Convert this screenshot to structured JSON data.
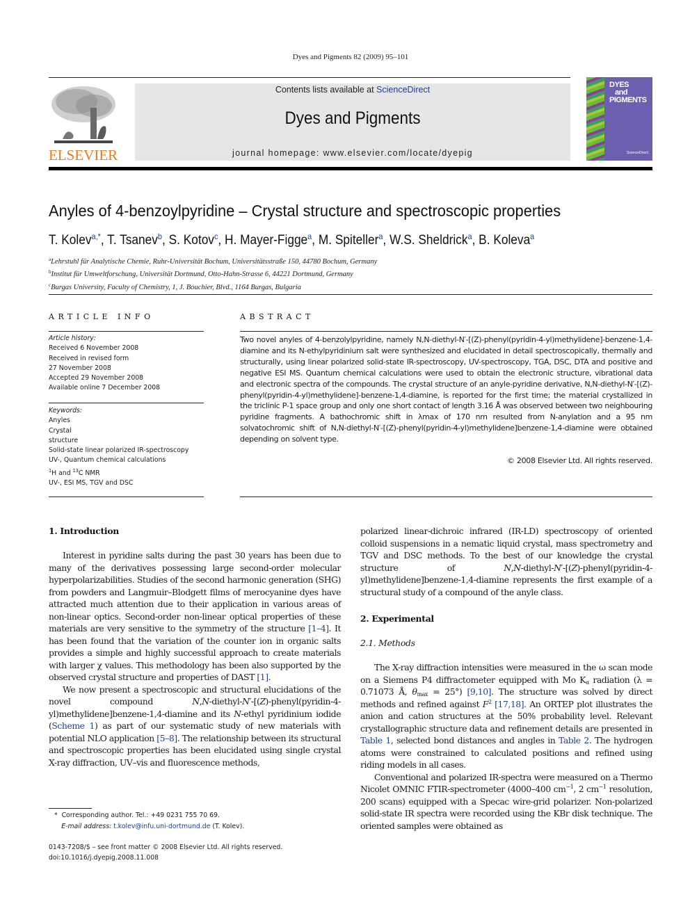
{
  "running_head": "Dyes and Pigments 82 (2009) 95–101",
  "publisher": {
    "logo_text": "ELSEVIER",
    "logo_icon": "elsevier-tree-icon",
    "brand_color": "#e87a1e"
  },
  "banner": {
    "contents_prefix": "Contents lists available at ",
    "contents_link": "ScienceDirect",
    "journal_title": "Dyes and Pigments",
    "homepage_label": "journal homepage: www.elsevier.com/locate/dyepig"
  },
  "cover": {
    "title_lines": [
      "DYES",
      "and",
      "PIGMENTS"
    ],
    "publisher_mark": "ScienceDirect"
  },
  "article": {
    "title": "Anyles of 4-benzoylpyridine – Crystal structure and spectroscopic properties",
    "authors": [
      {
        "name": "T. Kolev",
        "aff": "a,*"
      },
      {
        "name": "T. Tsanev",
        "aff": "b"
      },
      {
        "name": "S. Kotov",
        "aff": "c"
      },
      {
        "name": "H. Mayer-Figge",
        "aff": "a"
      },
      {
        "name": "M. Spiteller",
        "aff": "a"
      },
      {
        "name": "W.S. Sheldrick",
        "aff": "a"
      },
      {
        "name": "B. Koleva",
        "aff": "a"
      }
    ],
    "affiliations": [
      {
        "key": "a",
        "text": "Lehrstuhl für Analytische Chemie, Ruhr-Universität Bochum, Universitätsstraße 150, 44780 Bochum, Germany"
      },
      {
        "key": "b",
        "text": "Institut für Umweltforschung, Universität Dortmund, Otto-Hahn-Strasse 6, 44221 Dortmund, Germany"
      },
      {
        "key": "c",
        "text": "Burgas University, Faculty of Chemistry, 1, J. Bouchier, Blvd., 1164 Burgas, Bulgaria"
      }
    ]
  },
  "article_info": {
    "label": "ARTICLE INFO",
    "history_heading": "Article history:",
    "history": [
      "Received 6 November 2008",
      "Received in revised form",
      "27 November 2008",
      "Accepted 29 November 2008",
      "Available online 7 December 2008"
    ],
    "keywords_heading": "Keywords:",
    "keywords": [
      "Anyles",
      "Crystal",
      "structure",
      "Solid-state linear polarized IR-spectroscopy",
      "UV-, Quantum chemical calculations",
      "1H and 13C NMR",
      "UV-, ESI MS, TGV and DSC"
    ]
  },
  "abstract": {
    "label": "ABSTRACT",
    "text": "Two novel anyles of 4-benzolylpyridine, namely N,N-diethyl-N′-[(Z)-phenyl(pyridin-4-yl)methylidene]-benzene-1,4-diamine and its N-ethylpyridinium salt were synthesized and elucidated in detail spectroscopically, thermally and structurally, using linear polarized solid-state IR-spectroscopy, UV-spectroscopy, TGA, DSC, DTA and positive and negative ESI MS. Quantum chemical calculations were used to obtain the electronic structure, vibrational data and electronic spectra of the compounds. The crystal structure of an anyle-pyridine derivative, N,N-diethyl-N′-[(Z)-phenyl(pyridin-4-yl)methylidene]-benzene-1,4-diamine, is reported for the first time; the material crystallized in the triclinic P-1 space group and only one short contact of length 3.16 Å was observed between two neighbouring pyridine fragments. A bathochromic shift in λmax of 170 nm resulted from N-anylation and a 95 nm solvatochromic shift of N,N-diethyl-N′-[(Z)-phenyl(pyridin-4-yl)methylidene]benzene-1,4-diamine were obtained depending on solvent type.",
    "copyright": "© 2008 Elsevier Ltd. All rights reserved."
  },
  "body": {
    "intro_heading": "1.  Introduction",
    "intro_paragraphs": [
      "Interest in pyridine salts during the past 30 years has been due to many of the derivatives possessing large second-order molecular hyperpolarizabilities. Studies of the second harmonic generation (SHG) from powders and Langmuir–Blodgett films of merocyanine dyes have attracted much attention due to their application in various areas of non-linear optics. Second-order non-linear optical properties of these materials are very sensitive to the symmetry of the structure [1–4]. It has been found that the variation of the counter ion in organic salts provides a simple and highly successful approach to create materials with larger χ values. This methodology has been also supported by the observed crystal structure and properties of DAST [1].",
      "We now present a spectroscopic and structural elucidations of the novel compound N,N-diethyl-N′-[(Z)-phenyl(pyridin-4-yl)methylidene]benzene-1,4-diamine and its N-ethyl pyridinium iodide (Scheme 1) as part of our systematic study of new materials with potential NLO application [5–8]. The relationship between its structural and spectroscopic properties has been elucidated using single crystal X-ray diffraction, UV–vis and fluorescence methods, polarized linear-dichroic infrared (IR-LD) spectroscopy of oriented colloid suspensions in a nematic liquid crystal, mass spectrometry and TGV and DSC methods. To the best of our knowledge the crystal structure of N,N-diethyl-N′-[(Z)-phenyl(pyridin-4-yl)methylidene]benzene-1,4-diamine represents the first example of a structural study of a compound of the anyle class."
    ],
    "refs": {
      "r1_4": "[1–4]",
      "r1": "[1]",
      "scheme1": "Scheme 1",
      "r5_8": "[5–8]",
      "r9_10": "[9,10]",
      "r17_18": "[17,18]",
      "table1": "Table 1",
      "table2": "Table 2"
    },
    "experimental_heading": "2.  Experimental",
    "methods_heading": "2.1.  Methods",
    "methods_paragraphs": [
      "The X-ray diffraction intensities were measured in the ω scan mode on a Siemens P4 diffractometer equipped with Mo Kα radiation (λ = 0.71073 Å, θmax = 25°) [9,10]. The structure was solved by direct methods and refined against F2 [17,18]. An ORTEP plot illustrates the anion and cation structures at the 50% probability level. Relevant crystallographic structure data and refinement details are presented in Table 1, selected bond distances and angles in Table 2. The hydrogen atoms were constrained to calculated positions and refined using riding models in all cases.",
      "Conventional and polarized IR-spectra were measured on a Thermo Nicolet OMNIC FTIR-spectrometer (4000–400 cm−1, 2 cm−1 resolution, 200 scans) equipped with a Specac wire-grid polarizer. Non-polarized solid-state IR spectra were recorded using the KBr disk technique. The oriented samples were obtained as"
    ]
  },
  "footnote": {
    "corresponding": "Corresponding author. Tel.: +49 0231 755 70 69.",
    "email_label": "E-mail address:",
    "email": "t.kolev@infu.uni-dortmund.de",
    "email_suffix": "(T. Kolev)."
  },
  "front_matter": {
    "issn_line": "0143-7208/$ – see front matter © 2008 Elsevier Ltd. All rights reserved.",
    "doi": "doi:10.1016/j.dyepig.2008.11.008"
  }
}
